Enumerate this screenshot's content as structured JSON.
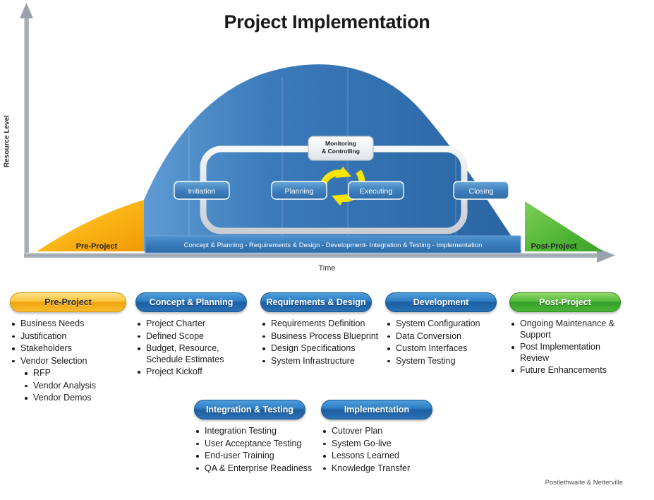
{
  "title": "Project Implementation",
  "chart_data": {
    "type": "area",
    "title": "Project Implementation",
    "xlabel": "Time",
    "ylabel": "Resource Level",
    "grid": false,
    "legend_position": "none",
    "x_axis_label": "Time",
    "y_axis_label": "Resource Level",
    "regions": [
      {
        "name": "Pre-Project",
        "label": "Pre-Project",
        "color": "#f5a81c",
        "shape": "rising-triangle",
        "x_range": [
          0,
          18
        ]
      },
      {
        "name": "Project",
        "label": "Concept & Planning - Requirements & Design - Development- Integration & Testing - Implementation",
        "color": "#3574b5",
        "shape": "bell-curve",
        "x_range": [
          18,
          88
        ]
      },
      {
        "name": "Post-Project",
        "label": "Post-Project",
        "color": "#56b940",
        "shape": "falling-triangle",
        "x_range": [
          88,
          100
        ]
      }
    ],
    "series": [
      {
        "name": "Resource Level",
        "x": [
          0,
          10,
          18,
          25,
          35,
          45,
          55,
          62,
          70,
          78,
          84,
          88,
          94,
          100
        ],
        "values": [
          0,
          8,
          22,
          48,
          78,
          95,
          100,
          97,
          88,
          70,
          45,
          28,
          12,
          0
        ]
      }
    ]
  },
  "chart": {
    "y_axis_label": "Resource Level",
    "x_axis_label": "Time",
    "pre_project_label": "Pre-Project",
    "post_project_label": "Post-Project",
    "phase_banner": "Concept & Planning - Requirements & Design - Development- Integration & Testing - Implementation",
    "monitoring_line1": "Monitoring",
    "monitoring_line2": "& Controlling",
    "process_nodes": [
      {
        "label": "Initiation"
      },
      {
        "label": "Planning"
      },
      {
        "label": "Executing"
      },
      {
        "label": "Closing"
      }
    ]
  },
  "columns": [
    {
      "header": "Pre-Project",
      "color": "orange",
      "items": [
        {
          "text": "Business Needs",
          "level": 1
        },
        {
          "text": "Justification",
          "level": 1
        },
        {
          "text": "Stakeholders",
          "level": 1
        },
        {
          "text": "Vendor Selection",
          "level": 1
        },
        {
          "text": "RFP",
          "level": 2
        },
        {
          "text": "Vendor Analysis",
          "level": 2
        },
        {
          "text": "Vendor Demos",
          "level": 2
        }
      ]
    },
    {
      "header": "Concept & Planning",
      "color": "blue",
      "items": [
        {
          "text": "Project Charter",
          "level": 1
        },
        {
          "text": "Defined Scope",
          "level": 1
        },
        {
          "text": "Budget, Resource, Schedule Estimates",
          "level": 1
        },
        {
          "text": "Project Kickoff",
          "level": 1
        }
      ]
    },
    {
      "header": "Requirements & Design",
      "color": "blue",
      "items": [
        {
          "text": "Requirements Definition",
          "level": 1
        },
        {
          "text": "Business Process Blueprint",
          "level": 1
        },
        {
          "text": "Design Specifications",
          "level": 1
        },
        {
          "text": "System Infrastructure",
          "level": 1
        }
      ]
    },
    {
      "header": "Development",
      "color": "blue",
      "items": [
        {
          "text": "System Configuration",
          "level": 1
        },
        {
          "text": "Data Conversion",
          "level": 1
        },
        {
          "text": "Custom Interfaces",
          "level": 1
        },
        {
          "text": "System Testing",
          "level": 1
        }
      ]
    },
    {
      "header": "Post-Project",
      "color": "green",
      "items": [
        {
          "text": "Ongoing Maintenance & Support",
          "level": 1
        },
        {
          "text": "Post Implementation Review",
          "level": 1
        },
        {
          "text": "Future Enhancements",
          "level": 1
        }
      ]
    },
    {
      "header": "Integration & Testing",
      "color": "blue",
      "items": [
        {
          "text": "Integration Testing",
          "level": 1
        },
        {
          "text": "User Acceptance Testing",
          "level": 1
        },
        {
          "text": "End-user Training",
          "level": 1
        },
        {
          "text": "QA & Enterprise Readiness",
          "level": 1
        }
      ]
    },
    {
      "header": "Implementation",
      "color": "blue",
      "items": [
        {
          "text": "Cutover Plan",
          "level": 1
        },
        {
          "text": "System Go-live",
          "level": 1
        },
        {
          "text": "Lessons Learned",
          "level": 1
        },
        {
          "text": "Knowledge Transfer",
          "level": 1
        }
      ]
    }
  ],
  "credit": "Postlethwaite & Netterville",
  "colors": {
    "blue": "#3574b5",
    "orange": "#f5a81c",
    "green": "#56b940",
    "yellow_arrow": "#f5e400",
    "axis_gray": "#9aa3ad"
  }
}
